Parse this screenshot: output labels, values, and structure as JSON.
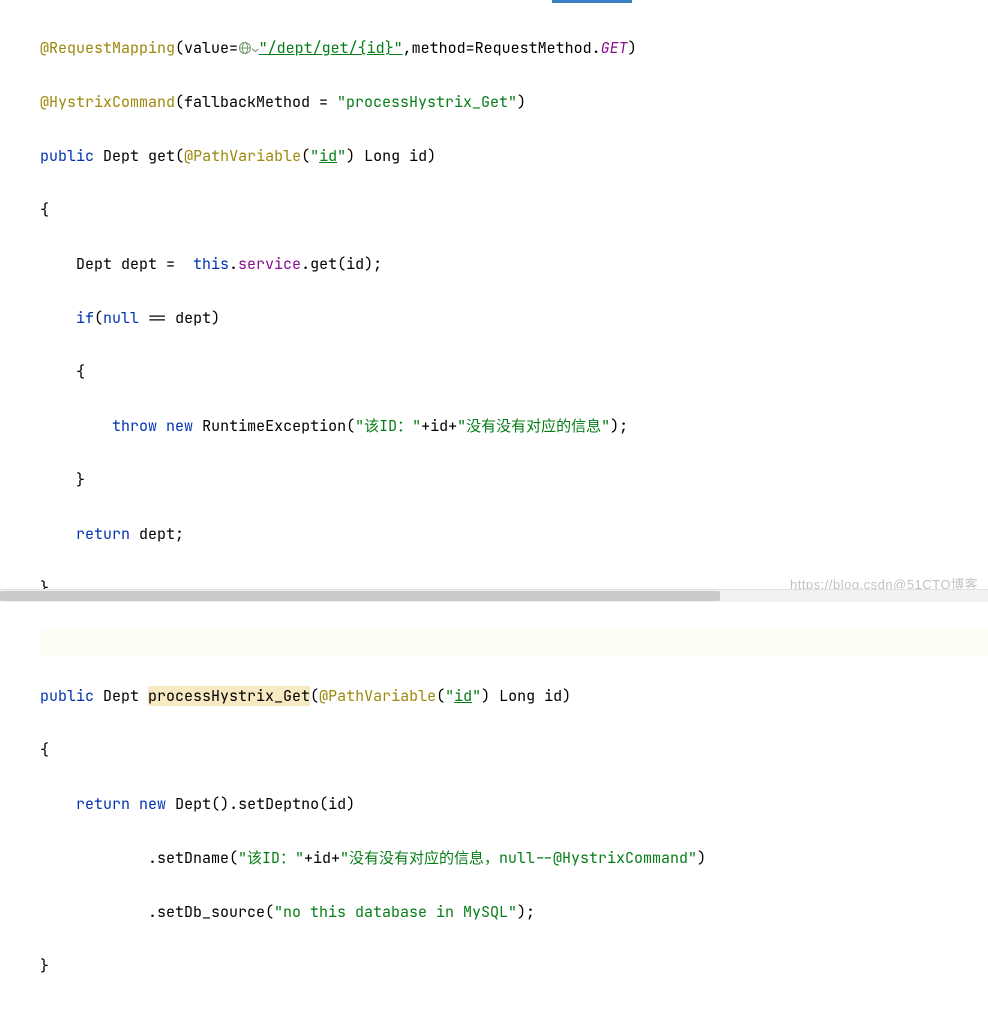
{
  "code": {
    "l1_ann": "@RequestMapping",
    "l1_value_attr": "(value=",
    "l1_url": "\"/dept/get/{id}\"",
    "l1_method_attr": ",method=RequestMethod.",
    "l1_get": "GET",
    "l1_close": ")",
    "l2_ann": "@HystrixCommand",
    "l2_args": "(fallbackMethod = ",
    "l2_str": "\"processHystrix_Get\"",
    "l2_close": ")",
    "l3_public": "public",
    "l3_type": " Dept ",
    "l3_name": "get",
    "l3_open": "(",
    "l3_ann": "@PathVariable",
    "l3_pv_open": "(",
    "l3_pv_str_q1": "\"",
    "l3_pv_id": "id",
    "l3_pv_str_q2": "\"",
    "l3_pv_close": ") Long id)",
    "l4": "{",
    "l5_a": "    Dept dept =  ",
    "l5_this": "this",
    "l5_dot": ".",
    "l5_service": "service",
    "l5_call": ".get(id);",
    "l6_a": "    ",
    "l6_if": "if",
    "l6_cond_open": "(",
    "l6_null": "null",
    "l6_cond_rest": " == dept)",
    "l7": "    {",
    "l8_indent": "        ",
    "l8_throw": "throw",
    "l8_sp": " ",
    "l8_new": "new",
    "l8_rte": " RuntimeException(",
    "l8_str1": "\"该ID：\"",
    "l8_plus1": "+id+",
    "l8_str2": "\"没有没有对应的信息\"",
    "l8_close": ");",
    "l9": "    }",
    "l10_indent": "    ",
    "l10_return": "return",
    "l10_rest": " dept;",
    "l11": "}",
    "l13_public": "public",
    "l13_type": " Dept ",
    "l13_name": "processHystrix_Get",
    "l13_open": "(",
    "l13_ann": "@PathVariable",
    "l13_pv_open": "(",
    "l13_pv_str_q1": "\"",
    "l13_pv_id": "id",
    "l13_pv_str_q2": "\"",
    "l13_pv_close": ") Long id)",
    "l14": "{",
    "l15_indent": "    ",
    "l15_return": "return",
    "l15_sp": " ",
    "l15_new": "new",
    "l15_rest": " Dept().setDeptno(id)",
    "l16_indent": "            .setDname(",
    "l16_str1": "\"该ID：\"",
    "l16_plus": "+id+",
    "l16_str2": "\"没有没有对应的信息，null--@HystrixCommand\"",
    "l16_close": ")",
    "l17_indent": "            .setDb_source(",
    "l17_str": "\"no this database in MySQL\"",
    "l17_close": ");",
    "l18": "}"
  },
  "watermark": "https://blog.csdn@51CTO博客"
}
